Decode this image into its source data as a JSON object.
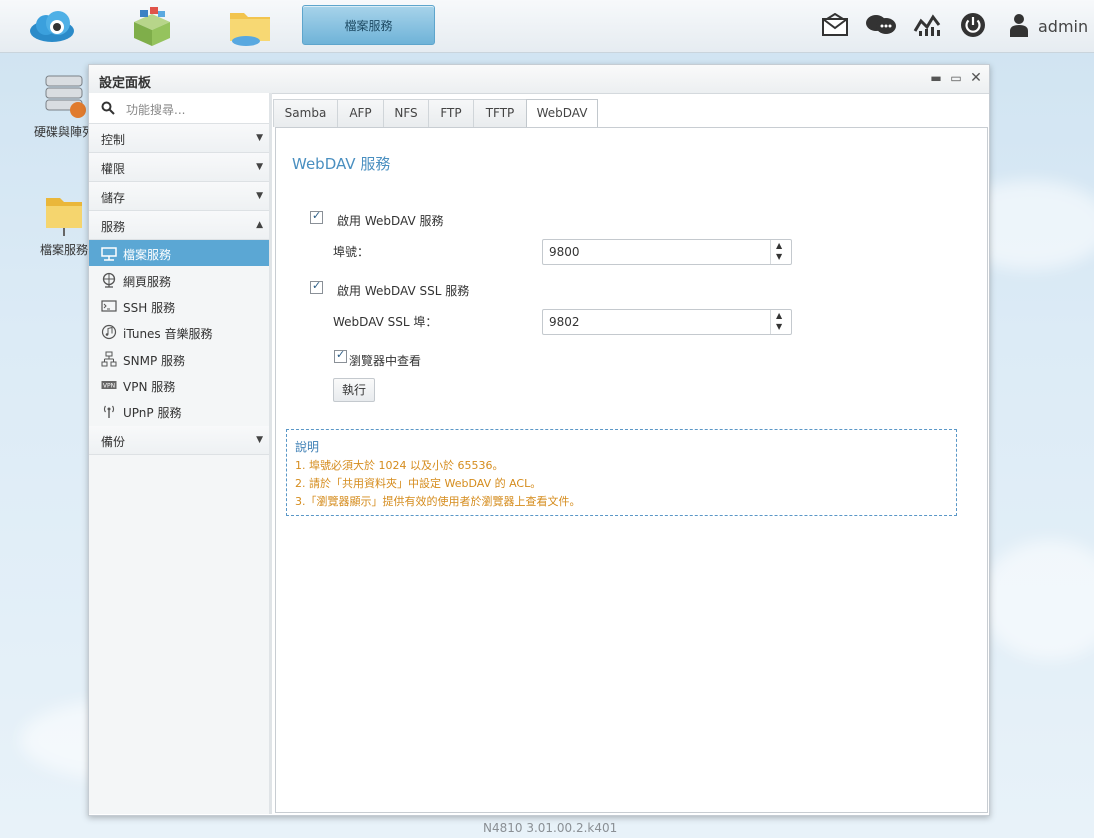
{
  "topbar": {
    "task_label": "檔案服務",
    "user": "admin"
  },
  "desktop": {
    "icons": [
      {
        "label": "硬碟與陣列"
      },
      {
        "label": "檔案服務"
      }
    ]
  },
  "window": {
    "title": "設定面板"
  },
  "sidebar": {
    "search_placeholder": "功能搜尋...",
    "sections": [
      {
        "label": "控制"
      },
      {
        "label": "權限"
      },
      {
        "label": "儲存"
      },
      {
        "label": "服務"
      }
    ],
    "items": [
      {
        "label": "檔案服務"
      },
      {
        "label": "網頁服務"
      },
      {
        "label": "SSH 服務"
      },
      {
        "label": "iTunes 音樂服務"
      },
      {
        "label": "SNMP 服務"
      },
      {
        "label": "VPN 服務"
      },
      {
        "label": "UPnP 服務"
      }
    ],
    "backup": {
      "label": "備份"
    }
  },
  "tabs": [
    "Samba",
    "AFP",
    "NFS",
    "FTP",
    "TFTP",
    "WebDAV"
  ],
  "form": {
    "title": "WebDAV 服務",
    "enable_label": "啟用 WebDAV 服務",
    "port_label": "埠號：",
    "port_value": "9800",
    "enable_ssl_label": "啟用 WebDAV SSL 服務",
    "ssl_port_label": "WebDAV SSL 埠：",
    "ssl_port_value": "9802",
    "browser_view_label": "瀏覽器中查看",
    "apply_label": "執行"
  },
  "note": {
    "heading": "說明",
    "lines": [
      "1. 埠號必須大於 1024 以及小於 65536。",
      "2. 請於「共用資料夾」中設定 WebDAV 的 ACL。",
      "3.「瀏覽器顯示」提供有效的使用者於瀏覽器上查看文件。"
    ]
  },
  "footer": {
    "text": "N4810   3.01.00.2.k401"
  },
  "colors": {
    "accent": "#5ba7d4",
    "title": "#4a8fc0",
    "note_text": "#d58c1d"
  }
}
